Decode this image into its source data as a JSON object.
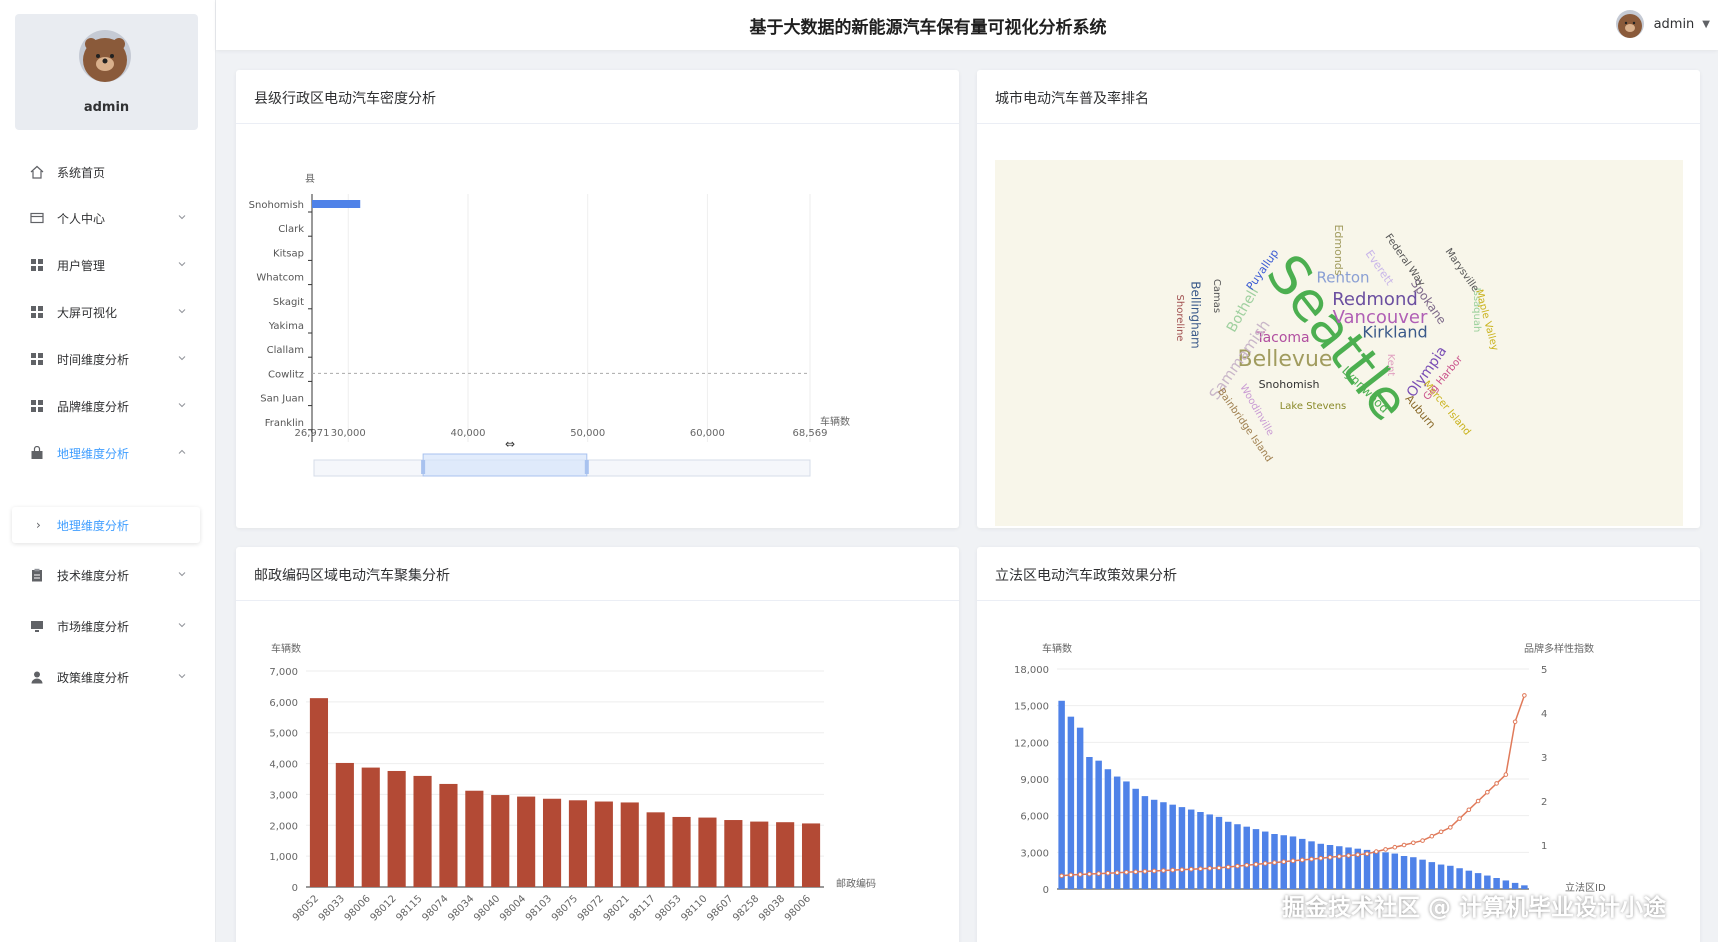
{
  "app": {
    "title": "基于大数据的新能源汽车保有量可视化分析系统",
    "user": "admin"
  },
  "sidebar": {
    "profile_name": "admin",
    "items": [
      {
        "label": "系统首页",
        "icon": "home-icon",
        "expandable": false
      },
      {
        "label": "个人中心",
        "icon": "card-icon",
        "expandable": true
      },
      {
        "label": "用户管理",
        "icon": "grid-icon",
        "expandable": true
      },
      {
        "label": "大屏可视化",
        "icon": "grid-icon",
        "expandable": true
      },
      {
        "label": "时间维度分析",
        "icon": "grid-icon",
        "expandable": true
      },
      {
        "label": "品牌维度分析",
        "icon": "grid-icon",
        "expandable": true
      },
      {
        "label": "地理维度分析",
        "icon": "bag-icon",
        "expandable": true,
        "active": true
      },
      {
        "label": "技术维度分析",
        "icon": "clipboard-icon",
        "expandable": true
      },
      {
        "label": "市场维度分析",
        "icon": "monitor-icon",
        "expandable": true
      },
      {
        "label": "政策维度分析",
        "icon": "user-icon",
        "expandable": true
      }
    ],
    "sub_item": "地理维度分析"
  },
  "cards": {
    "county": {
      "title": "县级行政区电动汽车密度分析"
    },
    "city": {
      "title": "城市电动汽车普及率排名"
    },
    "postal": {
      "title": "邮政编码区域电动汽车聚集分析"
    },
    "legislative": {
      "title": "立法区电动汽车政策效果分析"
    }
  },
  "watermark": "掘金技术社区 @ 计算机毕业设计小途",
  "colors": {
    "accent": "#409eff",
    "bar_blue": "#4f82e8",
    "bar_red": "#b34a35",
    "line_orange": "#e07a5a",
    "wordcloud_bg": "#f8f6ea"
  },
  "chart_data": [
    {
      "type": "bar",
      "orientation": "horizontal",
      "ylabel": "县",
      "xlabel": "车辆数",
      "categories": [
        "Snohomish",
        "Clark",
        "Kitsap",
        "Whatcom",
        "Skagit",
        "Yakima",
        "Clallam",
        "Cowlitz",
        "San Juan",
        "Franklin"
      ],
      "values": [
        31000,
        0,
        0,
        0,
        0,
        0,
        0,
        0,
        0,
        0
      ],
      "x_ticks": [
        "26,971",
        "30,000",
        "40,000",
        "50,000",
        "60,000",
        "68,569"
      ],
      "xlim": [
        26971,
        68569
      ],
      "dashed_line": "Cowlitz",
      "zoom_slider": [
        0.22,
        0.55
      ]
    },
    {
      "type": "wordcloud",
      "words": [
        {
          "text": "Seattle",
          "color": "#4caf50",
          "size": 54,
          "rotate": 52
        },
        {
          "text": "Bellevue",
          "color": "#a19c5f",
          "size": 22,
          "rotate": 0
        },
        {
          "text": "Redmond",
          "color": "#6b4fa0",
          "size": 18,
          "rotate": 0
        },
        {
          "text": "Vancouver",
          "color": "#b05fb5",
          "size": 18,
          "rotate": 0
        },
        {
          "text": "Kirkland",
          "color": "#3b5a8a",
          "size": 16,
          "rotate": 0
        },
        {
          "text": "Renton",
          "color": "#8a9fd4",
          "size": 15,
          "rotate": 0
        },
        {
          "text": "Tacoma",
          "color": "#b14fa0",
          "size": 14,
          "rotate": 0
        },
        {
          "text": "Sammamish",
          "color": "#c9b6c9",
          "size": 15,
          "rotate": -55
        },
        {
          "text": "Bothell",
          "color": "#9fd09f",
          "size": 14,
          "rotate": -60
        },
        {
          "text": "Olympia",
          "color": "#7a4fb5",
          "size": 14,
          "rotate": -55
        },
        {
          "text": "Spokane",
          "color": "#7e6a8a",
          "size": 12,
          "rotate": 55
        },
        {
          "text": "Snohomish",
          "color": "#333333",
          "size": 11,
          "rotate": 0
        },
        {
          "text": "Lynnwood",
          "color": "#4caf50",
          "size": 12,
          "rotate": 45
        },
        {
          "text": "Lake Stevens",
          "color": "#8a8a2a",
          "size": 10,
          "rotate": 0
        },
        {
          "text": "Auburn",
          "color": "#8a6a2a",
          "size": 11,
          "rotate": 50
        },
        {
          "text": "Mercer Island",
          "color": "#c9b21c",
          "size": 10,
          "rotate": 50
        },
        {
          "text": "Gig Harbor",
          "color": "#c94f8a",
          "size": 10,
          "rotate": -50
        },
        {
          "text": "Issaquah",
          "color": "#9ad09a",
          "size": 10,
          "rotate": 90
        },
        {
          "text": "Maple Valley",
          "color": "#c9b21c",
          "size": 10,
          "rotate": 75
        },
        {
          "text": "Marysville",
          "color": "#555555",
          "size": 10,
          "rotate": 55
        },
        {
          "text": "Federal Way",
          "color": "#555555",
          "size": 10,
          "rotate": 55
        },
        {
          "text": "Everett",
          "color": "#c9b6e9",
          "size": 11,
          "rotate": 55
        },
        {
          "text": "Edmonds",
          "color": "#a19c5f",
          "size": 11,
          "rotate": 90
        },
        {
          "text": "Puyallup",
          "color": "#3b5ad4",
          "size": 11,
          "rotate": -55
        },
        {
          "text": "Camas",
          "color": "#555555",
          "size": 10,
          "rotate": 90
        },
        {
          "text": "Bellingham",
          "color": "#3b5a8a",
          "size": 12,
          "rotate": 90
        },
        {
          "text": "Shoreline",
          "color": "#a05050",
          "size": 10,
          "rotate": 90
        },
        {
          "text": "Woodinville",
          "color": "#c99bd4",
          "size": 10,
          "rotate": 60
        },
        {
          "text": "Bainbridge Island",
          "color": "#a08050",
          "size": 10,
          "rotate": 55
        },
        {
          "text": "Kent",
          "color": "#e0a0c0",
          "size": 10,
          "rotate": 90
        }
      ]
    },
    {
      "type": "bar",
      "ylabel": "车辆数",
      "xlabel": "邮政编码",
      "categories": [
        "98052",
        "98033",
        "98006",
        "98012",
        "98115",
        "98074",
        "98034",
        "98040",
        "98004",
        "98103",
        "98075",
        "98072",
        "98021",
        "98117",
        "98053",
        "98110",
        "98607",
        "98258",
        "98038",
        "98006"
      ],
      "values": [
        6120,
        4020,
        3870,
        3760,
        3600,
        3340,
        3120,
        2980,
        2930,
        2860,
        2810,
        2770,
        2740,
        2420,
        2270,
        2250,
        2170,
        2120,
        2100,
        2060
      ],
      "ylim": [
        0,
        7000
      ],
      "y_ticks": [
        "0",
        "1,000",
        "2,000",
        "3,000",
        "4,000",
        "5,000",
        "6,000",
        "7,000"
      ]
    },
    {
      "type": "bar",
      "dual_axis": true,
      "ylabel": "车辆数",
      "y2label": "品牌多样性指数",
      "xlabel": "立法区ID",
      "ylim": [
        0,
        18000
      ],
      "y2lim": [
        0,
        5
      ],
      "y_ticks": [
        "0",
        "3,000",
        "6,000",
        "9,000",
        "12,000",
        "15,000",
        "18,000"
      ],
      "y2_ticks": [
        "1",
        "2",
        "3",
        "4",
        "5"
      ],
      "values": [
        15400,
        14100,
        13200,
        10800,
        10500,
        9800,
        9200,
        8800,
        8200,
        7600,
        7300,
        7100,
        6900,
        6700,
        6500,
        6300,
        6100,
        5900,
        5500,
        5300,
        5100,
        4900,
        4700,
        4500,
        4400,
        4300,
        4100,
        3900,
        3700,
        3600,
        3500,
        3400,
        3300,
        3200,
        3100,
        3000,
        2900,
        2700,
        2600,
        2400,
        2200,
        2000,
        1900,
        1700,
        1500,
        1300,
        1100,
        900,
        700,
        500,
        300
      ],
      "line": [
        0.3,
        0.32,
        0.33,
        0.34,
        0.35,
        0.36,
        0.37,
        0.38,
        0.39,
        0.4,
        0.41,
        0.42,
        0.43,
        0.44,
        0.45,
        0.46,
        0.47,
        0.48,
        0.5,
        0.52,
        0.54,
        0.56,
        0.58,
        0.6,
        0.62,
        0.64,
        0.66,
        0.68,
        0.7,
        0.72,
        0.74,
        0.76,
        0.78,
        0.8,
        0.85,
        0.9,
        0.95,
        1.0,
        1.05,
        1.1,
        1.2,
        1.3,
        1.4,
        1.6,
        1.8,
        2.0,
        2.2,
        2.4,
        2.6,
        3.8,
        4.4
      ]
    }
  ]
}
